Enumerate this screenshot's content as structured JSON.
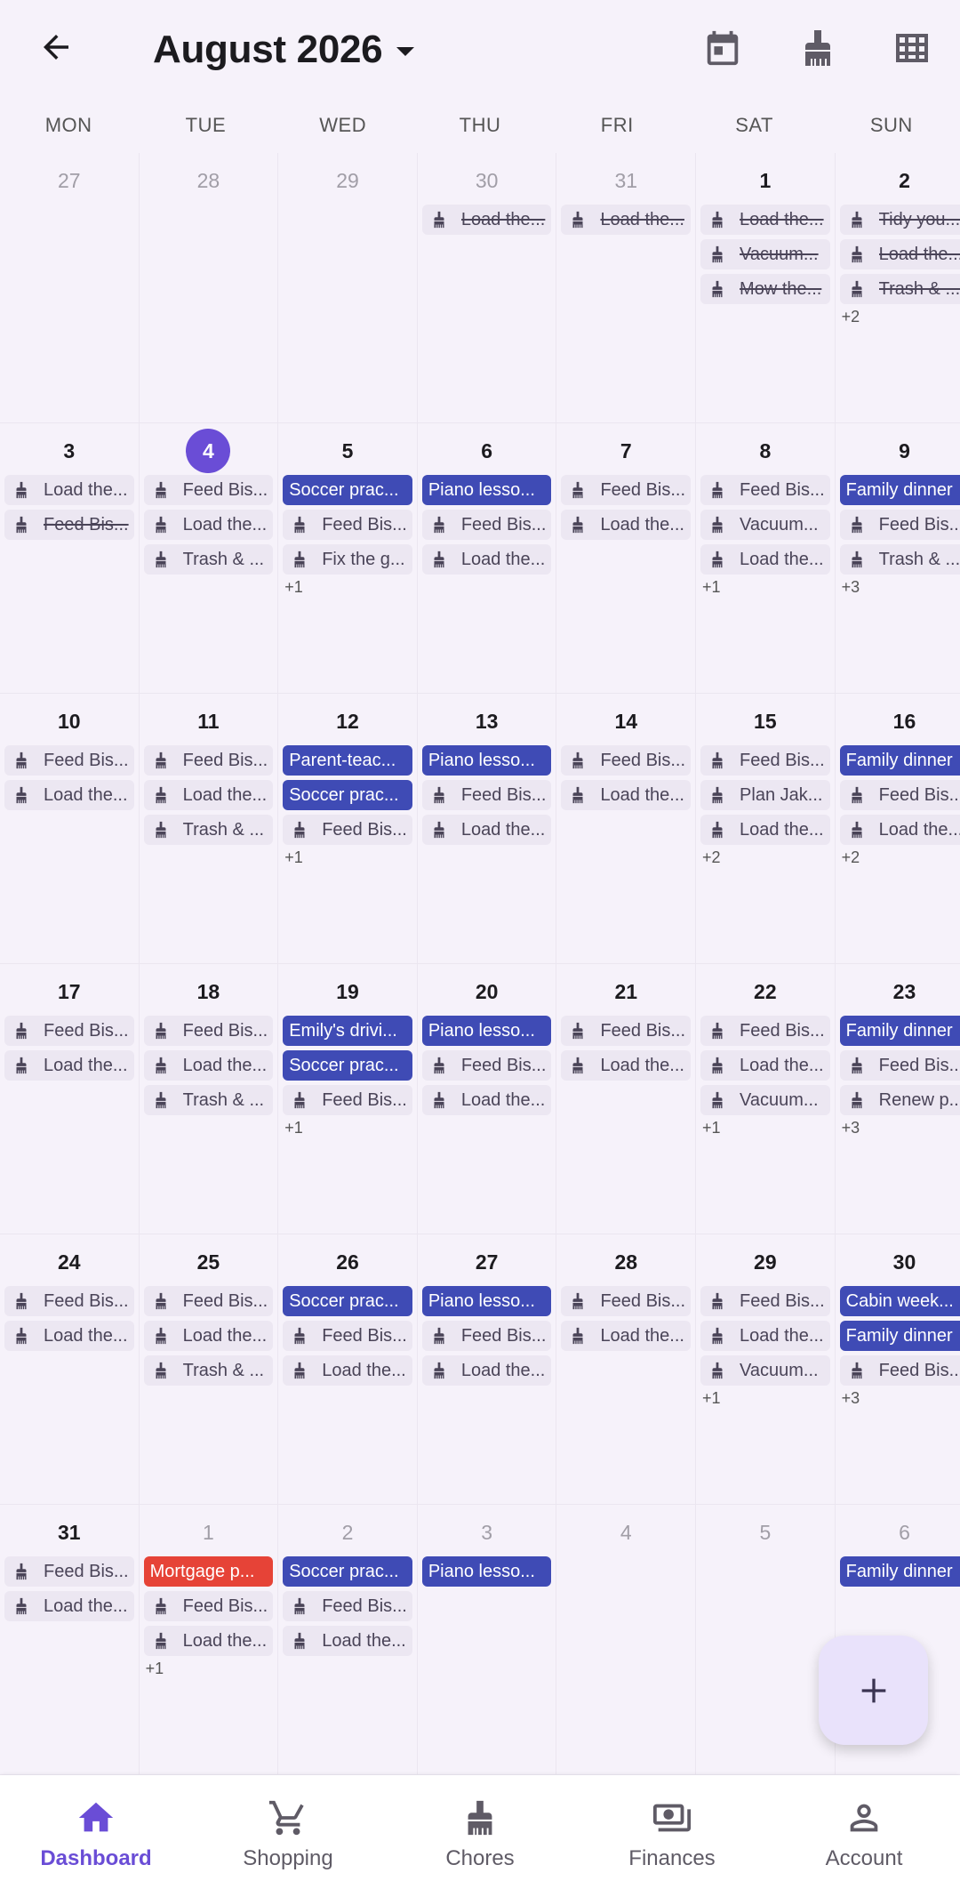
{
  "header": {
    "title": "August 2026"
  },
  "weekdays": [
    "MON",
    "TUE",
    "WED",
    "THU",
    "FRI",
    "SAT",
    "SUN"
  ],
  "colors": {
    "accent": "#6a4dd6",
    "event": "#3f4bb5",
    "urgent": "#e64337",
    "chore_bg": "#ece7f2"
  },
  "weeks": [
    [
      {
        "d": "27",
        "out": true,
        "items": []
      },
      {
        "d": "28",
        "out": true,
        "items": []
      },
      {
        "d": "29",
        "out": true,
        "items": []
      },
      {
        "d": "30",
        "out": true,
        "items": [
          {
            "k": "chore",
            "t": "Load the...",
            "done": true
          }
        ]
      },
      {
        "d": "31",
        "out": true,
        "items": [
          {
            "k": "chore",
            "t": "Load the...",
            "done": true
          }
        ]
      },
      {
        "d": "1",
        "items": [
          {
            "k": "chore",
            "t": "Load the...",
            "done": true
          },
          {
            "k": "chore",
            "t": "Vacuum...",
            "done": true
          },
          {
            "k": "chore",
            "t": "Mow the...",
            "done": true
          }
        ]
      },
      {
        "d": "2",
        "items": [
          {
            "k": "chore",
            "t": "Tidy you...",
            "done": true
          },
          {
            "k": "chore",
            "t": "Load the...",
            "done": true
          },
          {
            "k": "chore",
            "t": "Trash & ...",
            "done": true
          }
        ],
        "more": "+2"
      }
    ],
    [
      {
        "d": "3",
        "items": [
          {
            "k": "chore",
            "t": "Load the..."
          },
          {
            "k": "chore",
            "t": "Feed Bis...",
            "done": true
          }
        ]
      },
      {
        "d": "4",
        "today": true,
        "items": [
          {
            "k": "chore",
            "t": "Feed Bis..."
          },
          {
            "k": "chore",
            "t": "Load the..."
          },
          {
            "k": "chore",
            "t": "Trash & ..."
          }
        ]
      },
      {
        "d": "5",
        "items": [
          {
            "k": "event",
            "t": "Soccer prac..."
          },
          {
            "k": "chore",
            "t": "Feed Bis..."
          },
          {
            "k": "chore",
            "t": "Fix the g..."
          }
        ],
        "more": "+1"
      },
      {
        "d": "6",
        "items": [
          {
            "k": "event",
            "t": "Piano lesso..."
          },
          {
            "k": "chore",
            "t": "Feed Bis..."
          },
          {
            "k": "chore",
            "t": "Load the..."
          }
        ]
      },
      {
        "d": "7",
        "items": [
          {
            "k": "chore",
            "t": "Feed Bis..."
          },
          {
            "k": "chore",
            "t": "Load the..."
          }
        ]
      },
      {
        "d": "8",
        "items": [
          {
            "k": "chore",
            "t": "Feed Bis..."
          },
          {
            "k": "chore",
            "t": "Vacuum..."
          },
          {
            "k": "chore",
            "t": "Load the..."
          }
        ],
        "more": "+1"
      },
      {
        "d": "9",
        "items": [
          {
            "k": "event",
            "t": "Family dinner"
          },
          {
            "k": "chore",
            "t": "Feed Bis..."
          },
          {
            "k": "chore",
            "t": "Trash & ..."
          }
        ],
        "more": "+3"
      }
    ],
    [
      {
        "d": "10",
        "items": [
          {
            "k": "chore",
            "t": "Feed Bis..."
          },
          {
            "k": "chore",
            "t": "Load the..."
          }
        ]
      },
      {
        "d": "11",
        "items": [
          {
            "k": "chore",
            "t": "Feed Bis..."
          },
          {
            "k": "chore",
            "t": "Load the..."
          },
          {
            "k": "chore",
            "t": "Trash & ..."
          }
        ]
      },
      {
        "d": "12",
        "items": [
          {
            "k": "event",
            "t": "Parent-teac..."
          },
          {
            "k": "event",
            "t": "Soccer prac..."
          },
          {
            "k": "chore",
            "t": "Feed Bis..."
          }
        ],
        "more": "+1"
      },
      {
        "d": "13",
        "items": [
          {
            "k": "event",
            "t": "Piano lesso..."
          },
          {
            "k": "chore",
            "t": "Feed Bis..."
          },
          {
            "k": "chore",
            "t": "Load the..."
          }
        ]
      },
      {
        "d": "14",
        "items": [
          {
            "k": "chore",
            "t": "Feed Bis..."
          },
          {
            "k": "chore",
            "t": "Load the..."
          }
        ]
      },
      {
        "d": "15",
        "items": [
          {
            "k": "chore",
            "t": "Feed Bis..."
          },
          {
            "k": "chore",
            "t": "Plan Jak..."
          },
          {
            "k": "chore",
            "t": "Load the..."
          }
        ],
        "more": "+2"
      },
      {
        "d": "16",
        "items": [
          {
            "k": "event",
            "t": "Family dinner"
          },
          {
            "k": "chore",
            "t": "Feed Bis..."
          },
          {
            "k": "chore",
            "t": "Load the..."
          }
        ],
        "more": "+2"
      }
    ],
    [
      {
        "d": "17",
        "items": [
          {
            "k": "chore",
            "t": "Feed Bis..."
          },
          {
            "k": "chore",
            "t": "Load the..."
          }
        ]
      },
      {
        "d": "18",
        "items": [
          {
            "k": "chore",
            "t": "Feed Bis..."
          },
          {
            "k": "chore",
            "t": "Load the..."
          },
          {
            "k": "chore",
            "t": "Trash & ..."
          }
        ]
      },
      {
        "d": "19",
        "items": [
          {
            "k": "event",
            "t": "Emily's drivi..."
          },
          {
            "k": "event",
            "t": "Soccer prac..."
          },
          {
            "k": "chore",
            "t": "Feed Bis..."
          }
        ],
        "more": "+1"
      },
      {
        "d": "20",
        "items": [
          {
            "k": "event",
            "t": "Piano lesso..."
          },
          {
            "k": "chore",
            "t": "Feed Bis..."
          },
          {
            "k": "chore",
            "t": "Load the..."
          }
        ]
      },
      {
        "d": "21",
        "items": [
          {
            "k": "chore",
            "t": "Feed Bis..."
          },
          {
            "k": "chore",
            "t": "Load the..."
          }
        ]
      },
      {
        "d": "22",
        "items": [
          {
            "k": "chore",
            "t": "Feed Bis..."
          },
          {
            "k": "chore",
            "t": "Load the..."
          },
          {
            "k": "chore",
            "t": "Vacuum..."
          }
        ],
        "more": "+1"
      },
      {
        "d": "23",
        "items": [
          {
            "k": "event",
            "t": "Family dinner"
          },
          {
            "k": "chore",
            "t": "Feed Bis..."
          },
          {
            "k": "chore",
            "t": "Renew p..."
          }
        ],
        "more": "+3"
      }
    ],
    [
      {
        "d": "24",
        "items": [
          {
            "k": "chore",
            "t": "Feed Bis..."
          },
          {
            "k": "chore",
            "t": "Load the..."
          }
        ]
      },
      {
        "d": "25",
        "items": [
          {
            "k": "chore",
            "t": "Feed Bis..."
          },
          {
            "k": "chore",
            "t": "Load the..."
          },
          {
            "k": "chore",
            "t": "Trash & ..."
          }
        ]
      },
      {
        "d": "26",
        "items": [
          {
            "k": "event",
            "t": "Soccer prac..."
          },
          {
            "k": "chore",
            "t": "Feed Bis..."
          },
          {
            "k": "chore",
            "t": "Load the..."
          }
        ]
      },
      {
        "d": "27",
        "items": [
          {
            "k": "event",
            "t": "Piano lesso..."
          },
          {
            "k": "chore",
            "t": "Feed Bis..."
          },
          {
            "k": "chore",
            "t": "Load the..."
          }
        ]
      },
      {
        "d": "28",
        "items": [
          {
            "k": "chore",
            "t": "Feed Bis..."
          },
          {
            "k": "chore",
            "t": "Load the..."
          }
        ]
      },
      {
        "d": "29",
        "items": [
          {
            "k": "chore",
            "t": "Feed Bis..."
          },
          {
            "k": "chore",
            "t": "Load the..."
          },
          {
            "k": "chore",
            "t": "Vacuum..."
          }
        ],
        "more": "+1"
      },
      {
        "d": "30",
        "items": [
          {
            "k": "event",
            "t": "Cabin week..."
          },
          {
            "k": "event",
            "t": "Family dinner"
          },
          {
            "k": "chore",
            "t": "Feed Bis..."
          }
        ],
        "more": "+3"
      }
    ],
    [
      {
        "d": "31",
        "items": [
          {
            "k": "chore",
            "t": "Feed Bis..."
          },
          {
            "k": "chore",
            "t": "Load the..."
          }
        ]
      },
      {
        "d": "1",
        "out": true,
        "items": [
          {
            "k": "urgent",
            "t": "Mortgage p..."
          },
          {
            "k": "chore",
            "t": "Feed Bis..."
          },
          {
            "k": "chore",
            "t": "Load the..."
          }
        ],
        "more": "+1"
      },
      {
        "d": "2",
        "out": true,
        "items": [
          {
            "k": "event",
            "t": "Soccer prac..."
          },
          {
            "k": "chore",
            "t": "Feed Bis..."
          },
          {
            "k": "chore",
            "t": "Load the..."
          }
        ]
      },
      {
        "d": "3",
        "out": true,
        "items": [
          {
            "k": "event",
            "t": "Piano lesso..."
          }
        ]
      },
      {
        "d": "4",
        "out": true,
        "items": []
      },
      {
        "d": "5",
        "out": true,
        "items": []
      },
      {
        "d": "6",
        "out": true,
        "items": [
          {
            "k": "event",
            "t": "Family dinner"
          }
        ]
      }
    ]
  ],
  "nav": [
    {
      "label": "Dashboard",
      "icon": "home-icon",
      "active": true
    },
    {
      "label": "Shopping",
      "icon": "cart-icon"
    },
    {
      "label": "Chores",
      "icon": "broom-icon"
    },
    {
      "label": "Finances",
      "icon": "money-icon"
    },
    {
      "label": "Account",
      "icon": "person-icon"
    }
  ]
}
